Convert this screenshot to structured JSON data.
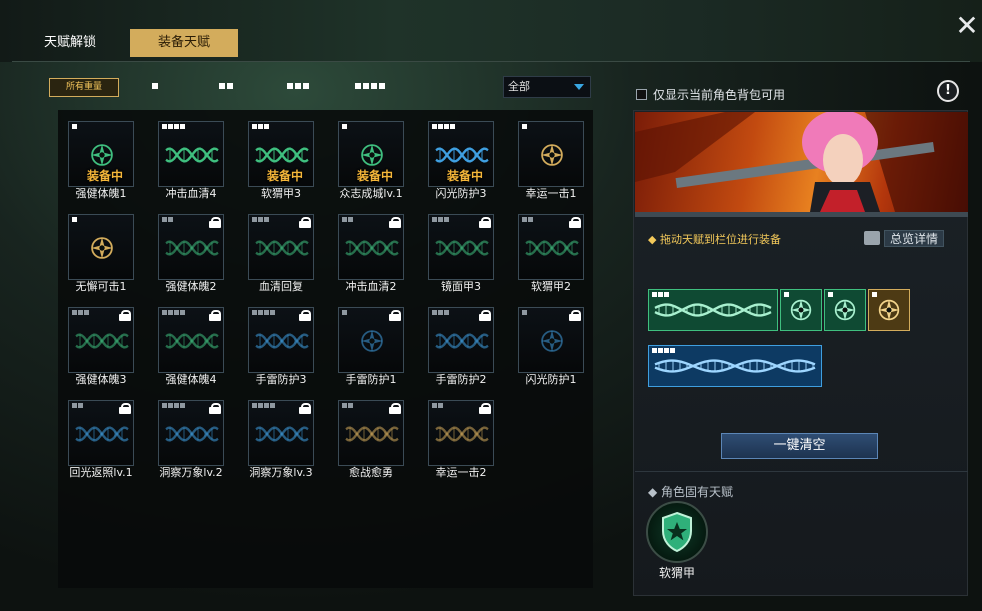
{
  "tabs": {
    "unlock": "天赋解锁",
    "equip": "装备天赋"
  },
  "filters": {
    "all_weight": "所有重量",
    "dropdown_value": "全部"
  },
  "equipped_label": "装备中",
  "cards": [
    {
      "name": "强健体魄1",
      "weight": 1,
      "color": "green",
      "kind": "emblem",
      "equipped": true,
      "locked": false
    },
    {
      "name": "冲击血清4",
      "weight": 4,
      "color": "green",
      "kind": "dna",
      "equipped": false,
      "locked": false
    },
    {
      "name": "软猬甲3",
      "weight": 3,
      "color": "green",
      "kind": "dna",
      "equipped": true,
      "locked": false
    },
    {
      "name": "众志成城lv.1",
      "weight": 1,
      "color": "green",
      "kind": "emblem",
      "equipped": true,
      "locked": false
    },
    {
      "name": "闪光防护3",
      "weight": 4,
      "color": "blue",
      "kind": "dna",
      "equipped": true,
      "locked": false
    },
    {
      "name": "幸运一击1",
      "weight": 1,
      "color": "gold",
      "kind": "emblem",
      "equipped": false,
      "locked": false
    },
    {
      "name": "无懈可击1",
      "weight": 1,
      "color": "gold",
      "kind": "emblem",
      "equipped": false,
      "locked": false
    },
    {
      "name": "强健体魄2",
      "weight": 2,
      "color": "green",
      "kind": "dna",
      "equipped": false,
      "locked": true
    },
    {
      "name": "血清回复",
      "weight": 3,
      "color": "green",
      "kind": "dna",
      "equipped": false,
      "locked": true
    },
    {
      "name": "冲击血清2",
      "weight": 2,
      "color": "green",
      "kind": "dna",
      "equipped": false,
      "locked": true
    },
    {
      "name": "镜面甲3",
      "weight": 3,
      "color": "green",
      "kind": "dna",
      "equipped": false,
      "locked": true
    },
    {
      "name": "软猬甲2",
      "weight": 2,
      "color": "green",
      "kind": "dna",
      "equipped": false,
      "locked": true
    },
    {
      "name": "强健体魄3",
      "weight": 3,
      "color": "green",
      "kind": "dna",
      "equipped": false,
      "locked": true
    },
    {
      "name": "强健体魄4",
      "weight": 4,
      "color": "green",
      "kind": "dna",
      "equipped": false,
      "locked": true
    },
    {
      "name": "手雷防护3",
      "weight": 4,
      "color": "blue",
      "kind": "dna",
      "equipped": false,
      "locked": true
    },
    {
      "name": "手雷防护1",
      "weight": 1,
      "color": "blue",
      "kind": "emblem",
      "equipped": false,
      "locked": true
    },
    {
      "name": "手雷防护2",
      "weight": 3,
      "color": "blue",
      "kind": "dna",
      "equipped": false,
      "locked": true
    },
    {
      "name": "闪光防护1",
      "weight": 1,
      "color": "blue",
      "kind": "emblem",
      "equipped": false,
      "locked": true
    },
    {
      "name": "回光返照lv.1",
      "weight": 2,
      "color": "blue",
      "kind": "dna",
      "equipped": false,
      "locked": true
    },
    {
      "name": "洞察万象lv.2",
      "weight": 4,
      "color": "blue",
      "kind": "dna",
      "equipped": false,
      "locked": true
    },
    {
      "name": "洞察万象lv.3",
      "weight": 4,
      "color": "blue",
      "kind": "dna",
      "equipped": false,
      "locked": true
    },
    {
      "name": "愈战愈勇",
      "weight": 2,
      "color": "gold",
      "kind": "dna",
      "equipped": false,
      "locked": true
    },
    {
      "name": "幸运一击2",
      "weight": 2,
      "color": "gold",
      "kind": "dna",
      "equipped": false,
      "locked": true
    }
  ],
  "right": {
    "only_current_label": "仅显示当前角色背包可用",
    "hint": "拖动天赋到栏位进行装备",
    "overview": "总览详情",
    "clear_button": "一键清空",
    "innate_header": "角色固有天赋",
    "innate_name": "软猬甲"
  },
  "slots_row1": [
    {
      "color": "green",
      "weight": 3,
      "kind": "dna",
      "span": 3
    },
    {
      "color": "green",
      "weight": 1,
      "kind": "emblem",
      "span": 1
    },
    {
      "color": "green",
      "weight": 1,
      "kind": "emblem",
      "span": 1
    },
    {
      "color": "gold",
      "weight": 1,
      "kind": "emblem",
      "span": 1
    }
  ],
  "slots_row2": [
    {
      "color": "blue",
      "weight": 4,
      "kind": "dna",
      "span": 4
    }
  ],
  "colors": {
    "green": "#3fbf7f",
    "blue": "#3f9fe0",
    "gold": "#d3ac5c",
    "accent": "#d3ac5c"
  }
}
